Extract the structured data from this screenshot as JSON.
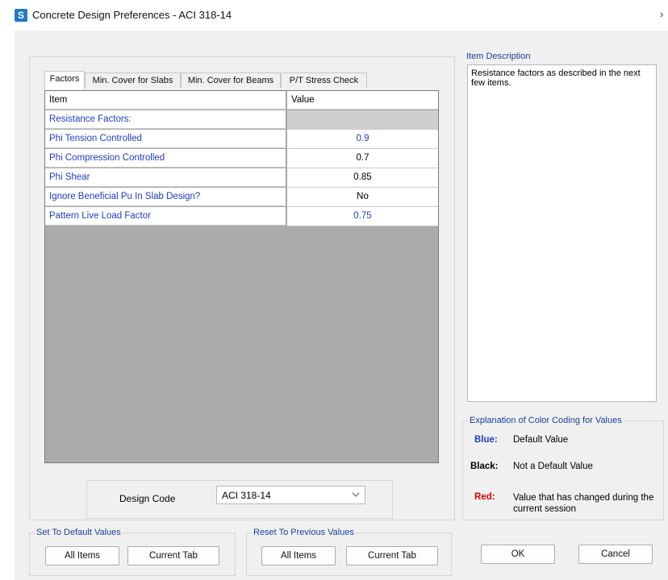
{
  "window": {
    "icon_letter": "S",
    "title": "Concrete Design Preferences - ACI 318-14",
    "close_glyph": "›"
  },
  "tabs": [
    {
      "label": "Factors",
      "active": true
    },
    {
      "label": "Min. Cover for Slabs",
      "active": false
    },
    {
      "label": "Min. Cover for Beams",
      "active": false
    },
    {
      "label": "P/T Stress Check",
      "active": false
    }
  ],
  "grid": {
    "headers": {
      "item": "Item",
      "value": "Value"
    },
    "rows": [
      {
        "item": "Resistance Factors:",
        "value": "",
        "color": "blue",
        "section": true
      },
      {
        "item": "Phi Tension Controlled",
        "value": "0.9",
        "color": "blue"
      },
      {
        "item": "Phi Compression Controlled",
        "value": "0.7",
        "color": "black"
      },
      {
        "item": "Phi Shear",
        "value": "0.85",
        "color": "black"
      },
      {
        "item": "Ignore Beneficial Pu In Slab Design?",
        "value": "No",
        "color": "black"
      },
      {
        "item": "Pattern Live Load Factor",
        "value": "0.75",
        "color": "blue"
      }
    ]
  },
  "design_code": {
    "label": "Design Code",
    "value": "ACI 318-14"
  },
  "item_description": {
    "title": "Item Description",
    "text": "Resistance factors as described in the next few items."
  },
  "color_legend": {
    "title": "Explanation of Color Coding for Values",
    "entries": [
      {
        "key": "Blue:",
        "desc": "Default Value",
        "color": "#1e3cc8"
      },
      {
        "key": "Black:",
        "desc": "Not a Default Value",
        "color": "#000000"
      },
      {
        "key": "Red:",
        "desc": "Value that has changed during the current session",
        "color": "#e00000"
      }
    ]
  },
  "set_default": {
    "title": "Set To Default Values",
    "all_items": "All Items",
    "current_tab": "Current Tab"
  },
  "reset_previous": {
    "title": "Reset To Previous Values",
    "all_items": "All Items",
    "current_tab": "Current Tab"
  },
  "buttons": {
    "ok": "OK",
    "cancel": "Cancel"
  }
}
